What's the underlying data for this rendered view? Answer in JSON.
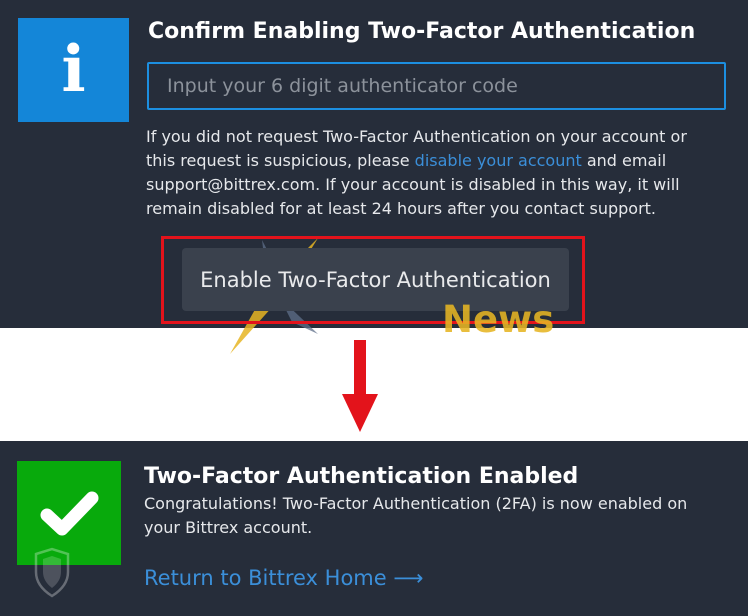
{
  "confirm": {
    "title": "Confirm Enabling Two-Factor Authentication",
    "info_icon": "info-icon",
    "code_placeholder": "Input your 6 digit authenticator code",
    "code_value": "",
    "note_line1": "If you did not request Two-Factor Authentication on your account or",
    "note_line2_prefix": "this request is suspicious, please ",
    "note_link": "disable your account",
    "note_line2_suffix": " and email",
    "note_line3": "support@bittrex.com. If your account is disabled in this way, it will",
    "note_line4": "remain disabled for at least 24 hours after you contact support.",
    "enable_button": "Enable Two-Factor Authentication"
  },
  "watermark": {
    "news": "News"
  },
  "enabled": {
    "title": "Two-Factor Authentication Enabled",
    "check_icon": "checkmark-icon",
    "message_line1": "Congratulations! Two-Factor Authentication (2FA) is now enabled on",
    "message_line2": "your Bittrex account.",
    "return_link": "Return to Bittrex Home",
    "return_arrow": "⟶"
  },
  "colors": {
    "panel": "#262d3a",
    "info_blue": "#1486d8",
    "success_green": "#08aa0c",
    "highlight_red": "#e3131b",
    "link_blue": "#3b8fd9"
  }
}
